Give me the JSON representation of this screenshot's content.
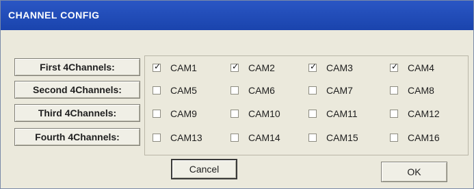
{
  "window": {
    "title": "CHANNEL CONFIG"
  },
  "rows": [
    {
      "label": "First 4Channels:"
    },
    {
      "label": "Second 4Channels:"
    },
    {
      "label": "Third 4Channels:"
    },
    {
      "label": "Fourth 4Channels:"
    }
  ],
  "channels": [
    {
      "label": "CAM1",
      "checked": true
    },
    {
      "label": "CAM2",
      "checked": true
    },
    {
      "label": "CAM3",
      "checked": true
    },
    {
      "label": "CAM4",
      "checked": true
    },
    {
      "label": "CAM5",
      "checked": false
    },
    {
      "label": "CAM6",
      "checked": false
    },
    {
      "label": "CAM7",
      "checked": false
    },
    {
      "label": "CAM8",
      "checked": false
    },
    {
      "label": "CAM9",
      "checked": false
    },
    {
      "label": "CAM10",
      "checked": false
    },
    {
      "label": "CAM11",
      "checked": false
    },
    {
      "label": "CAM12",
      "checked": false
    },
    {
      "label": "CAM13",
      "checked": false
    },
    {
      "label": "CAM14",
      "checked": false
    },
    {
      "label": "CAM15",
      "checked": false
    },
    {
      "label": "CAM16",
      "checked": false
    }
  ],
  "buttons": {
    "cancel": "Cancel",
    "ok": "OK"
  }
}
